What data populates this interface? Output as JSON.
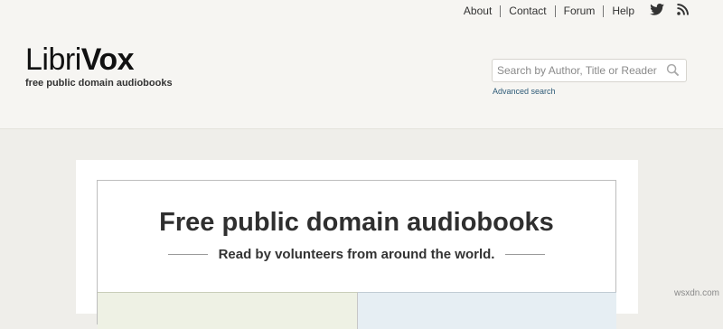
{
  "nav": {
    "links": [
      "About",
      "Contact",
      "Forum",
      "Help"
    ],
    "icons": [
      "twitter-icon",
      "rss-icon"
    ]
  },
  "brand": {
    "logo_part1": "Libri",
    "logo_part2": "Vox",
    "tagline": "free public domain audiobooks"
  },
  "search": {
    "placeholder": "Search by Author, Title or Reader",
    "value": "",
    "advanced_label": "Advanced search"
  },
  "hero": {
    "title": "Free public domain audiobooks",
    "subtitle": "Read by volunteers from around the world."
  },
  "watermark": "wsxdn.com",
  "colors": {
    "page_bg": "#efeeea",
    "header_bg": "#f6f5f2",
    "link_blue": "#2e5b78",
    "left_panel": "#eef1e4",
    "right_panel": "#e6eef3"
  }
}
